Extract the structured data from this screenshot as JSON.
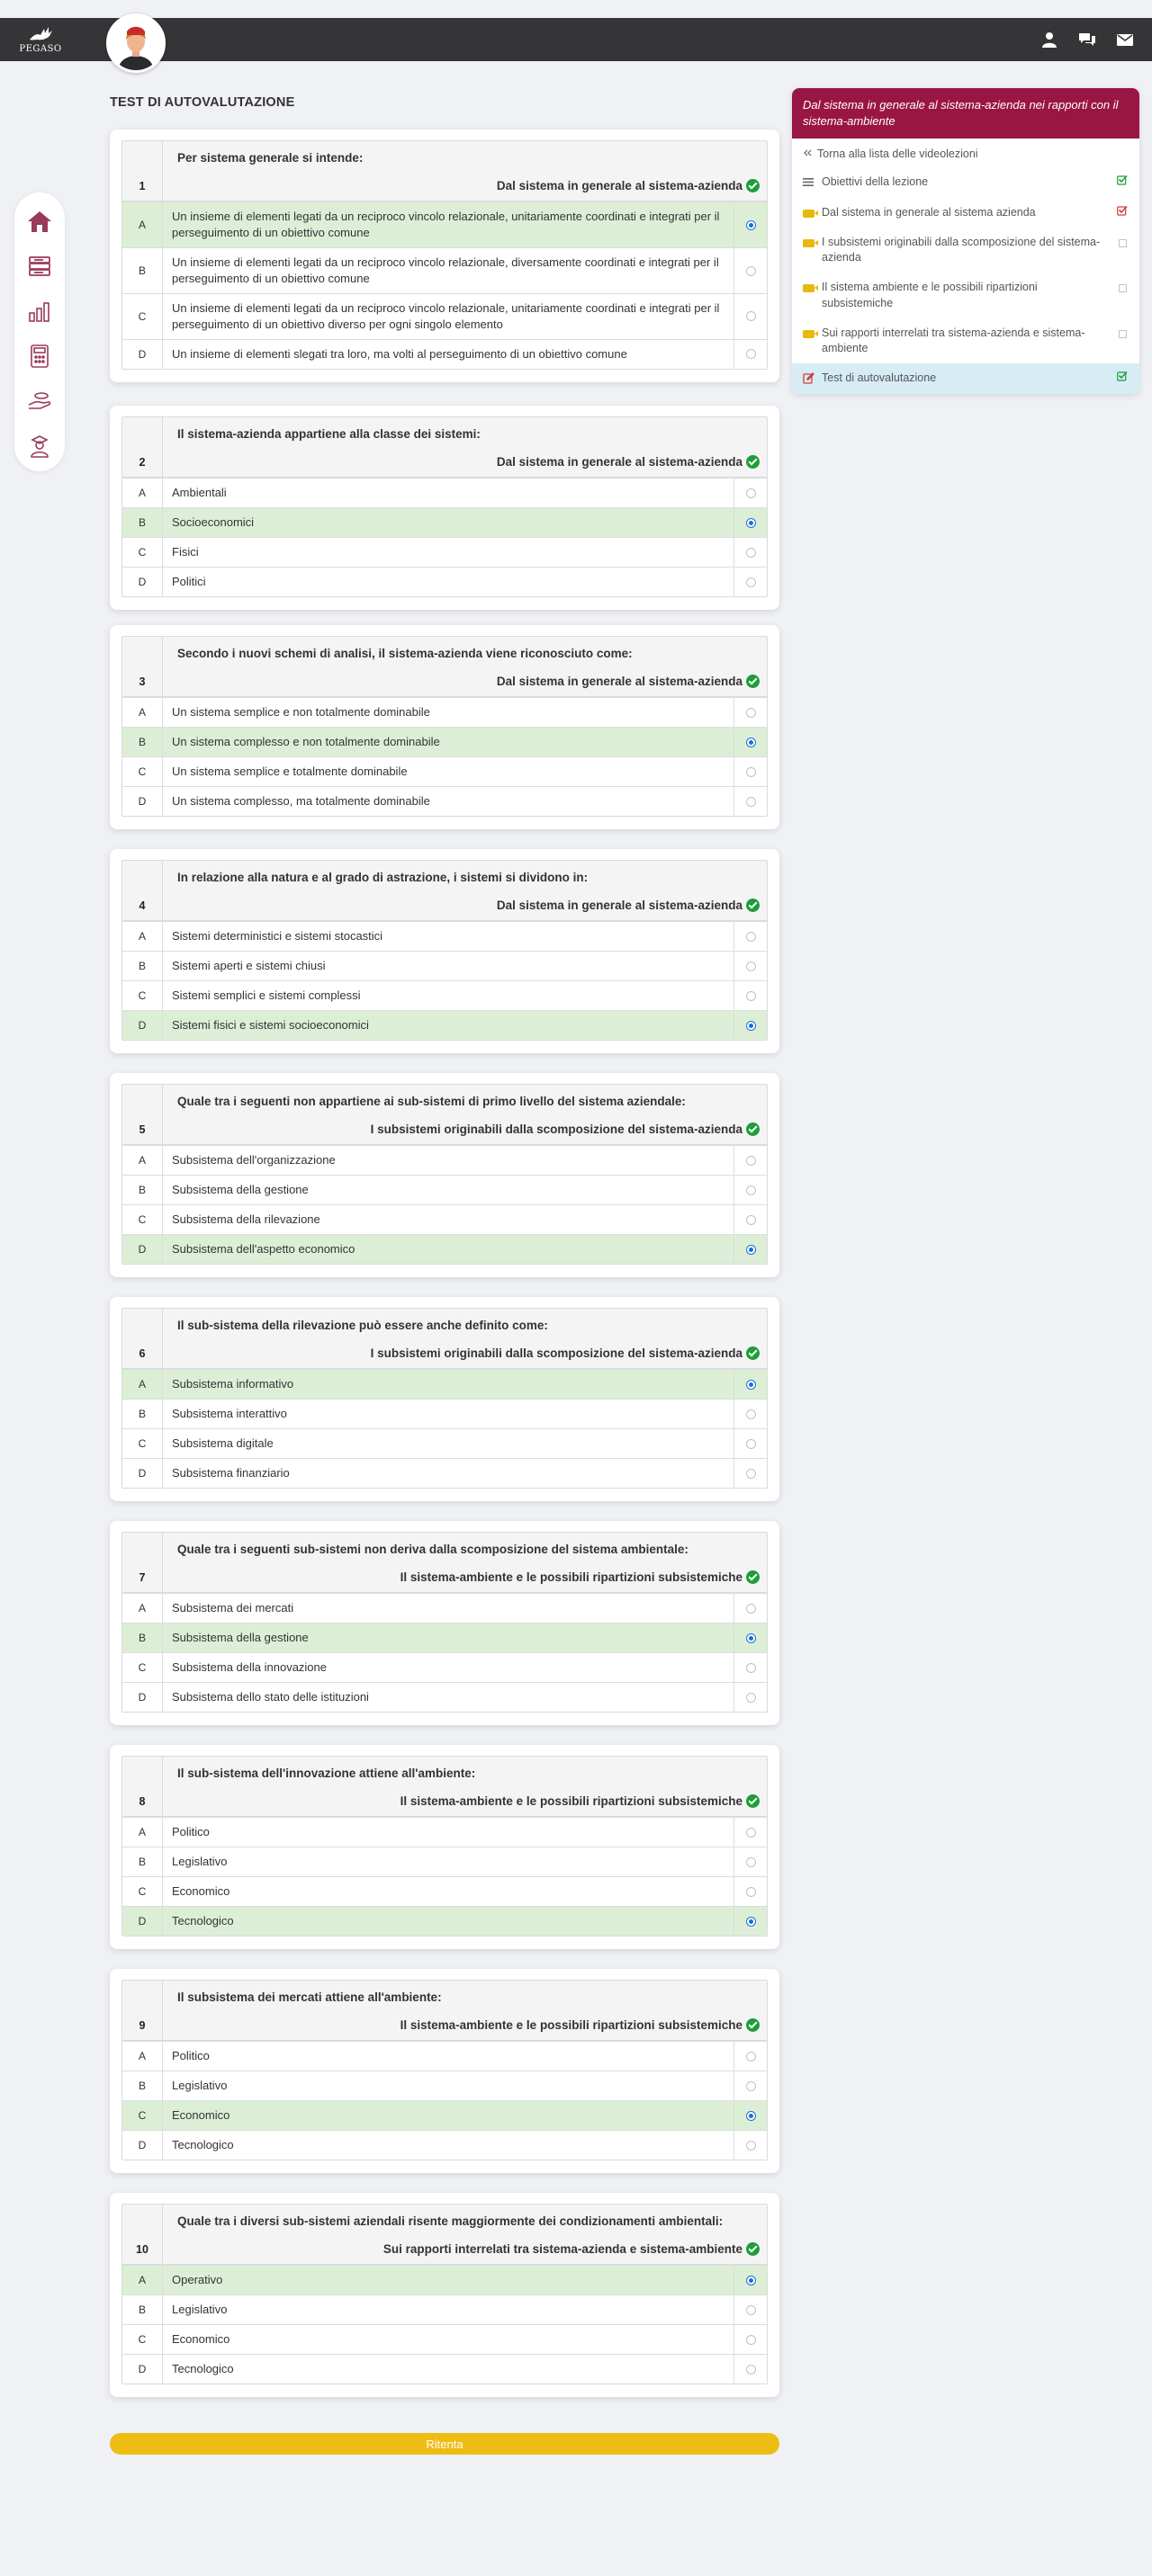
{
  "brand": {
    "logo_text": "PEGASO"
  },
  "header_icons": [
    "user-icon",
    "chat-icon",
    "mail-icon"
  ],
  "sidebar_icons": [
    "home-icon",
    "books-icon",
    "chart-icon",
    "calculator-icon",
    "hand-money-icon",
    "graduate-icon"
  ],
  "page_title": "TEST DI AUTOVALUTAZIONE",
  "questions": [
    {
      "number": "1",
      "text": "Per sistema generale si intende:",
      "topic": "Dal sistema in generale al sistema-azienda",
      "options": [
        {
          "letter": "A",
          "text": "Un insieme di elementi legati da un reciproco vincolo relazionale, unitariamente coordinati e integrati per il perseguimento di un obiettivo comune",
          "correct": true,
          "selected": true
        },
        {
          "letter": "B",
          "text": "Un insieme di elementi legati da un reciproco vincolo relazionale, diversamente coordinati e integrati per il perseguimento di un obiettivo comune",
          "correct": false,
          "selected": false
        },
        {
          "letter": "C",
          "text": "Un insieme di elementi legati da un reciproco vincolo relazionale, unitariamente coordinati e integrati per il perseguimento di un obiettivo diverso per ogni singolo elemento",
          "correct": false,
          "selected": false
        },
        {
          "letter": "D",
          "text": "Un insieme di elementi slegati tra loro, ma volti al perseguimento di un obiettivo comune",
          "correct": false,
          "selected": false
        }
      ]
    },
    {
      "number": "2",
      "text": "Il sistema-azienda appartiene alla classe dei sistemi:",
      "topic": "Dal sistema in generale al sistema-azienda",
      "options": [
        {
          "letter": "A",
          "text": "Ambientali",
          "correct": false,
          "selected": false
        },
        {
          "letter": "B",
          "text": "Socioeconomici",
          "correct": true,
          "selected": true
        },
        {
          "letter": "C",
          "text": "Fisici",
          "correct": false,
          "selected": false
        },
        {
          "letter": "D",
          "text": "Politici",
          "correct": false,
          "selected": false
        }
      ]
    },
    {
      "number": "3",
      "text": "Secondo i nuovi schemi di analisi, il sistema-azienda viene riconosciuto come:",
      "topic": "Dal sistema in generale al sistema-azienda",
      "options": [
        {
          "letter": "A",
          "text": "Un sistema semplice e non totalmente dominabile",
          "correct": false,
          "selected": false
        },
        {
          "letter": "B",
          "text": "Un sistema complesso e non totalmente dominabile",
          "correct": true,
          "selected": true
        },
        {
          "letter": "C",
          "text": "Un sistema semplice e totalmente dominabile",
          "correct": false,
          "selected": false
        },
        {
          "letter": "D",
          "text": "Un sistema complesso, ma totalmente dominabile",
          "correct": false,
          "selected": false
        }
      ]
    },
    {
      "number": "4",
      "text": "In relazione alla natura e al grado di astrazione, i sistemi si dividono in:",
      "topic": "Dal sistema in generale al sistema-azienda",
      "options": [
        {
          "letter": "A",
          "text": "Sistemi deterministici e sistemi stocastici",
          "correct": false,
          "selected": false
        },
        {
          "letter": "B",
          "text": "Sistemi aperti e sistemi chiusi",
          "correct": false,
          "selected": false
        },
        {
          "letter": "C",
          "text": "Sistemi semplici e sistemi complessi",
          "correct": false,
          "selected": false
        },
        {
          "letter": "D",
          "text": "Sistemi fisici e sistemi socioeconomici",
          "correct": true,
          "selected": true
        }
      ]
    },
    {
      "number": "5",
      "text": "Quale tra i seguenti non appartiene ai sub-sistemi di primo livello del sistema aziendale:",
      "topic": "I subsistemi originabili dalla scomposizione del sistema-azienda",
      "options": [
        {
          "letter": "A",
          "text": "Subsistema dell'organizzazione",
          "correct": false,
          "selected": false
        },
        {
          "letter": "B",
          "text": "Subsistema della gestione",
          "correct": false,
          "selected": false
        },
        {
          "letter": "C",
          "text": "Subsistema della rilevazione",
          "correct": false,
          "selected": false
        },
        {
          "letter": "D",
          "text": "Subsistema dell'aspetto economico",
          "correct": true,
          "selected": true
        }
      ]
    },
    {
      "number": "6",
      "text": "Il sub-sistema della rilevazione può essere anche definito come:",
      "topic": "I subsistemi originabili dalla scomposizione del sistema-azienda",
      "options": [
        {
          "letter": "A",
          "text": "Subsistema informativo",
          "correct": true,
          "selected": true
        },
        {
          "letter": "B",
          "text": "Subsistema interattivo",
          "correct": false,
          "selected": false
        },
        {
          "letter": "C",
          "text": "Subsistema digitale",
          "correct": false,
          "selected": false
        },
        {
          "letter": "D",
          "text": "Subsistema finanziario",
          "correct": false,
          "selected": false
        }
      ]
    },
    {
      "number": "7",
      "text": "Quale tra i seguenti sub-sistemi non deriva dalla scomposizione del sistema ambientale:",
      "topic": "Il sistema-ambiente e le possibili ripartizioni subsistemiche",
      "options": [
        {
          "letter": "A",
          "text": "Subsistema dei mercati",
          "correct": false,
          "selected": false
        },
        {
          "letter": "B",
          "text": "Subsistema della gestione",
          "correct": true,
          "selected": true
        },
        {
          "letter": "C",
          "text": "Subsistema della innovazione",
          "correct": false,
          "selected": false
        },
        {
          "letter": "D",
          "text": "Subsistema dello stato delle istituzioni",
          "correct": false,
          "selected": false
        }
      ]
    },
    {
      "number": "8",
      "text": "Il sub-sistema dell'innovazione attiene all'ambiente:",
      "topic": "Il sistema-ambiente e le possibili ripartizioni subsistemiche",
      "options": [
        {
          "letter": "A",
          "text": "Politico",
          "correct": false,
          "selected": false
        },
        {
          "letter": "B",
          "text": "Legislativo",
          "correct": false,
          "selected": false
        },
        {
          "letter": "C",
          "text": "Economico",
          "correct": false,
          "selected": false
        },
        {
          "letter": "D",
          "text": "Tecnologico",
          "correct": true,
          "selected": true
        }
      ]
    },
    {
      "number": "9",
      "text": "Il subsistema dei mercati attiene all'ambiente:",
      "topic": "Il sistema-ambiente e le possibili ripartizioni subsistemiche",
      "options": [
        {
          "letter": "A",
          "text": "Politico",
          "correct": false,
          "selected": false
        },
        {
          "letter": "B",
          "text": "Legislativo",
          "correct": false,
          "selected": false
        },
        {
          "letter": "C",
          "text": "Economico",
          "correct": true,
          "selected": true
        },
        {
          "letter": "D",
          "text": "Tecnologico",
          "correct": false,
          "selected": false
        }
      ]
    },
    {
      "number": "10",
      "text": "Quale tra i diversi sub-sistemi aziendali risente maggiormente dei condizionamenti ambientali:",
      "topic": "Sui rapporti interrelati tra sistema-azienda e sistema-ambiente",
      "options": [
        {
          "letter": "A",
          "text": "Operativo",
          "correct": true,
          "selected": true
        },
        {
          "letter": "B",
          "text": "Legislativo",
          "correct": false,
          "selected": false
        },
        {
          "letter": "C",
          "text": "Economico",
          "correct": false,
          "selected": false
        },
        {
          "letter": "D",
          "text": "Tecnologico",
          "correct": false,
          "selected": false
        }
      ]
    }
  ],
  "retry_label": "Ritenta",
  "panel": {
    "title": "Dal sistema in generale al sistema-azienda nei rapporti con il sistema-ambiente",
    "back_label": "Torna alla lista delle videolezioni",
    "items": [
      {
        "label": "Obiettivi della lezione",
        "icon": "list-icon",
        "state": "checked-green",
        "active": false
      },
      {
        "label": "Dal sistema in generale al sistema azienda",
        "icon": "video-icon",
        "state": "checked-red",
        "active": false
      },
      {
        "label": "I subsistemi originabili dalla scomposizione del sistema-azienda",
        "icon": "video-icon",
        "state": "empty",
        "active": false
      },
      {
        "label": "Il sistema ambiente e le possibili ripartizioni subsistemiche",
        "icon": "video-icon",
        "state": "empty",
        "active": false
      },
      {
        "label": "Sui rapporti interrelati tra sistema-azienda e sistema-ambiente",
        "icon": "video-icon",
        "state": "empty",
        "active": false
      },
      {
        "label": "Test di autovalutazione",
        "icon": "edit-icon",
        "state": "checked-green",
        "active": true
      }
    ]
  },
  "colors": {
    "topbar": "#353537",
    "panel_header": "#9a1642",
    "correct_row": "#dcefd6",
    "selected_radio": "#1a6fd6",
    "retry_button": "#eebd13",
    "active_item": "#d7edf5",
    "sidebar_icon": "#9a3a5a"
  }
}
